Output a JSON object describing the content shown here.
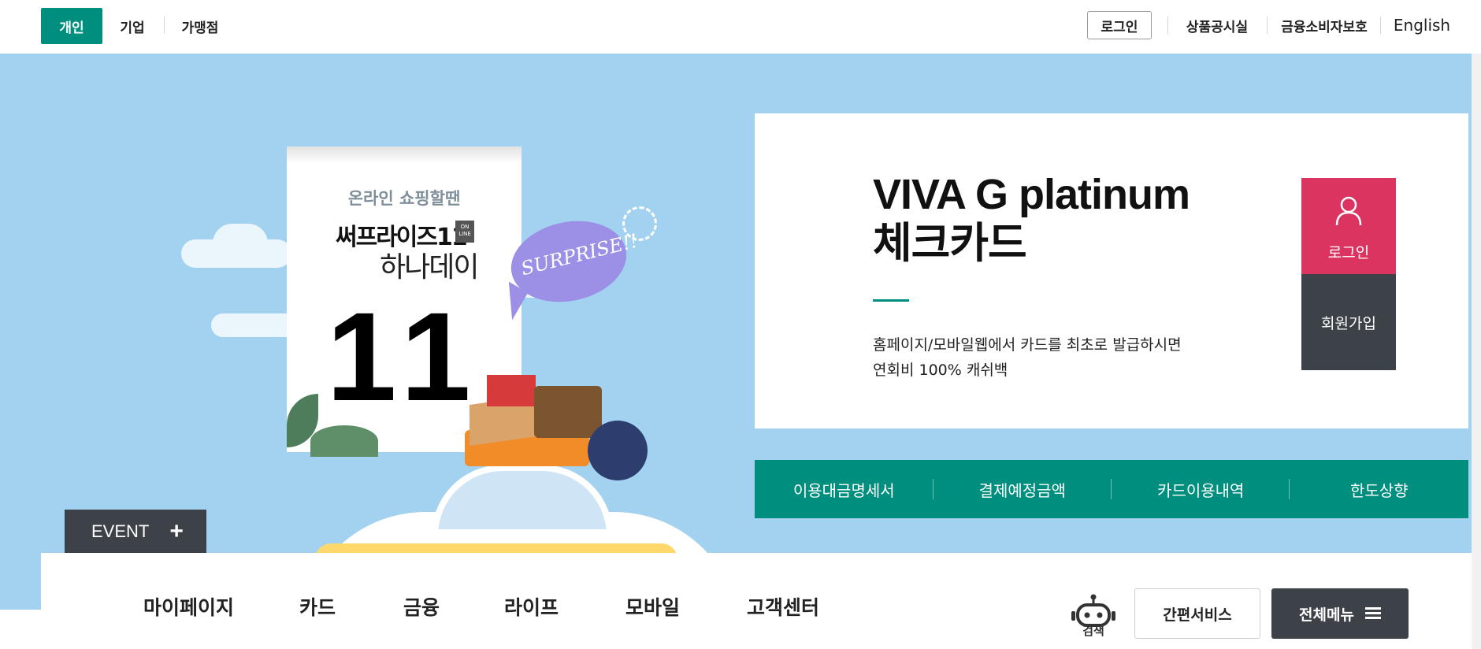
{
  "topbar": {
    "segments": [
      {
        "label": "개인",
        "active": true
      },
      {
        "label": "기업",
        "active": false
      },
      {
        "label": "가맹점",
        "active": false
      }
    ],
    "util": {
      "login": "로그인",
      "notice": "상품공시실",
      "protection": "금융소비자보호",
      "english": "English"
    }
  },
  "hero": {
    "calendar": {
      "subtitle": "온라인 쇼핑할땐",
      "brand_line1": "써프라이즈11",
      "badge": "ON LINE",
      "brand_line2": "하나데이",
      "day": "11"
    },
    "bubble": "SURPRISE!!",
    "event_button": "EVENT",
    "event_plus": "+"
  },
  "product": {
    "title_line1": "VIVA G platinum",
    "title_line2": "체크카드",
    "desc_line1": "홈페이지/모바일웹에서 카드를 최초로 발급하시면",
    "desc_line2": "연회비 100% 캐쉬백",
    "side_login": "로그인",
    "side_join": "회원가입"
  },
  "quick_menu": [
    "이용대금명세서",
    "결제예정금액",
    "카드이용내역",
    "한도상향"
  ],
  "gnb": {
    "items": [
      "마이페이지",
      "카드",
      "금융",
      "라이프",
      "모바일",
      "고객센터"
    ],
    "search_label": "검색",
    "simple_service": "간편서비스",
    "all_menu": "전체메뉴"
  },
  "colors": {
    "brand_green": "#008f7e",
    "hero_sky": "#a2d2ef",
    "login_pink": "#dc3461",
    "dark_gray": "#3d4148"
  }
}
